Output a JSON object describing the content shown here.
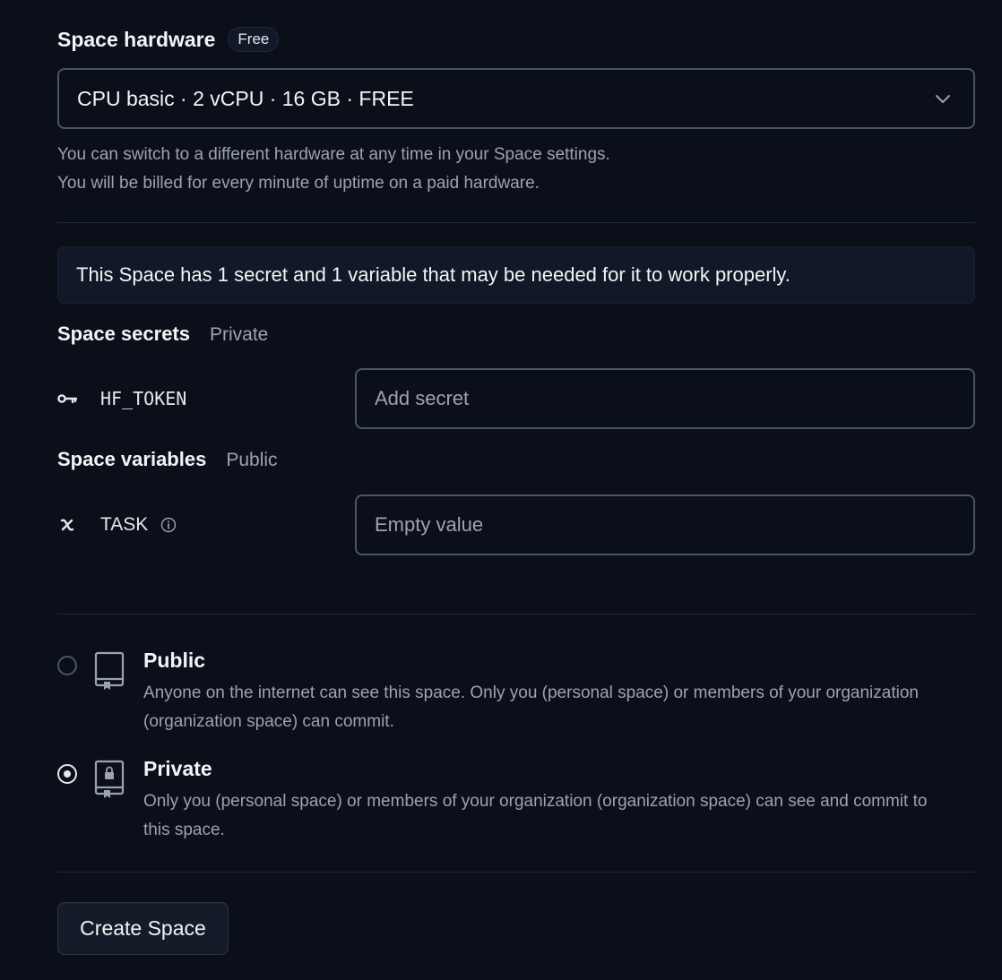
{
  "hardware": {
    "title": "Space hardware",
    "badge": "Free",
    "selected": "CPU basic · 2 vCPU · 16 GB · FREE",
    "help_line1": "You can switch to a different hardware at any time in your Space settings.",
    "help_line2": "You will be billed for every minute of uptime on a paid hardware."
  },
  "notice": "This Space has 1 secret and 1 variable that may be needed for it to work properly.",
  "secrets": {
    "title": "Space secrets",
    "scope": "Private",
    "items": [
      {
        "name": "HF_TOKEN",
        "icon": "key-icon",
        "placeholder": "Add secret"
      }
    ]
  },
  "variables": {
    "title": "Space variables",
    "scope": "Public",
    "items": [
      {
        "name": "TASK",
        "icon": "variable-icon",
        "placeholder": "Empty value"
      }
    ]
  },
  "visibility": {
    "selected": "private",
    "options": [
      {
        "id": "public",
        "title": "Public",
        "desc": "Anyone on the internet can see this space. Only you (personal space) or members of your organization (organization space) can commit."
      },
      {
        "id": "private",
        "title": "Private",
        "desc": "Only you (personal space) or members of your organization (organization space) can see and commit to this space."
      }
    ]
  },
  "actions": {
    "create_label": "Create Space"
  },
  "colors": {
    "background": "#0b0f19",
    "border": "#4b5563",
    "muted_text": "#9ca3af",
    "panel": "#111827"
  }
}
